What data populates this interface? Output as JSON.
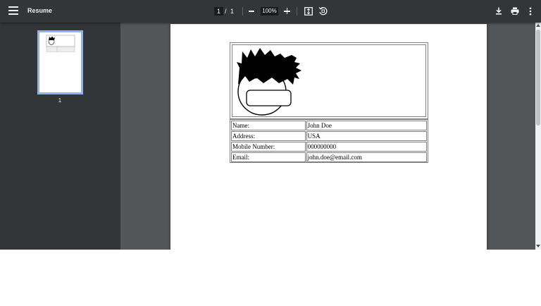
{
  "toolbar": {
    "title": "Resume",
    "current_page": "1",
    "page_separator": "/",
    "total_pages": "1",
    "zoom": "100%",
    "icons": [
      "menu-icon",
      "zoom-out-icon",
      "zoom-in-icon",
      "fit-to-page-icon",
      "rotate-icon",
      "download-icon",
      "print-icon",
      "more-options-icon"
    ]
  },
  "sidebar": {
    "thumbnails": [
      {
        "page_label": "1"
      }
    ]
  },
  "document": {
    "photo_icon": "cartoon-face-icon",
    "rows": [
      {
        "label": "Name:",
        "value": "John Doe"
      },
      {
        "label": "Address:",
        "value": "USA"
      },
      {
        "label": "Mobile Number:",
        "value": "000000000"
      },
      {
        "label": "Email:",
        "value": "john.doe@email.com"
      }
    ]
  },
  "colors": {
    "toolbar_bg": "#323639",
    "viewer_bg": "#525659",
    "thumbnail_border": "#8ab4f8",
    "icon_color": "#f1f1f1"
  }
}
